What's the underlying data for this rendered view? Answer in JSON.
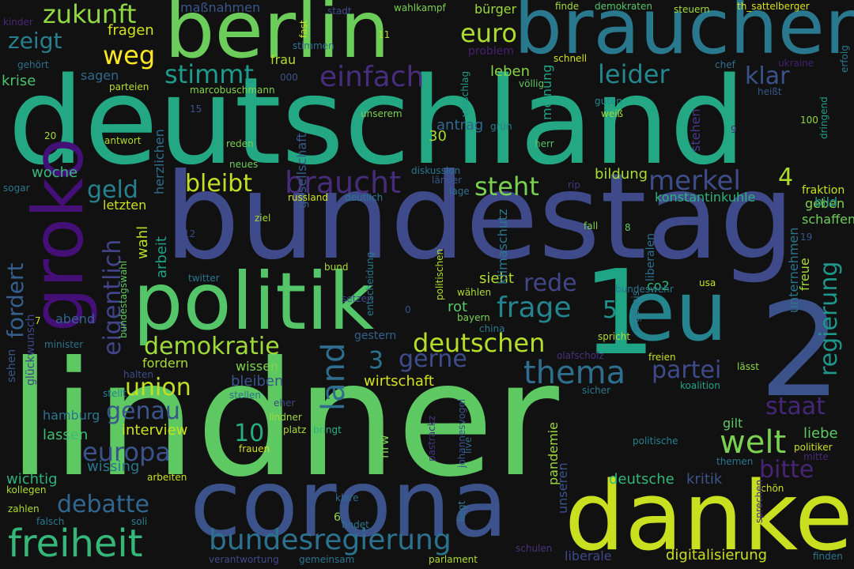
{
  "words": [
    {
      "text": "deutschland",
      "color": "#23a883"
    },
    {
      "text": "bundestag",
      "color": "#3f4a8a"
    },
    {
      "text": "lindner",
      "color": "#5ec962"
    },
    {
      "text": "corona",
      "color": "#3b528b"
    },
    {
      "text": "danke",
      "color": "#c8e020"
    },
    {
      "text": "brauchen",
      "color": "#2a788e"
    },
    {
      "text": "berlin",
      "color": "#6ccd5a"
    },
    {
      "text": "politik",
      "color": "#54c568"
    },
    {
      "text": "eu",
      "color": "#25858e"
    },
    {
      "text": "2",
      "color": "#3b528b"
    },
    {
      "text": "1",
      "color": "#20a486"
    },
    {
      "text": "groko",
      "color": "#440f76"
    },
    {
      "text": "freiheit",
      "color": "#35b779"
    },
    {
      "text": "bundesregierung",
      "color": "#2c728e"
    },
    {
      "text": "thema",
      "color": "#2e6e8e"
    },
    {
      "text": "welt",
      "color": "#7ad151"
    },
    {
      "text": "deutschen",
      "color": "#b5de2b"
    },
    {
      "text": "einfach",
      "color": "#472d7b"
    },
    {
      "text": "braucht",
      "color": "#472c7a"
    },
    {
      "text": "bleibt",
      "color": "#c2df23"
    },
    {
      "text": "steht",
      "color": "#7ad151"
    },
    {
      "text": "merkel",
      "color": "#3e4c8a"
    },
    {
      "text": "zukunft",
      "color": "#90d743"
    },
    {
      "text": "zeigt",
      "color": "#277f8e"
    },
    {
      "text": "weg",
      "color": "#fde725"
    },
    {
      "text": "euro",
      "color": "#addc30"
    },
    {
      "text": "stimmt",
      "color": "#1e9b8a"
    },
    {
      "text": "leider",
      "color": "#24868e"
    },
    {
      "text": "klar",
      "color": "#3b528b"
    },
    {
      "text": "demokratie",
      "color": "#9fda3a"
    },
    {
      "text": "frage",
      "color": "#25838e"
    },
    {
      "text": "rede",
      "color": "#404688"
    },
    {
      "text": "partei",
      "color": "#3e4a89"
    },
    {
      "text": "union",
      "color": "#c0df25"
    },
    {
      "text": "genau",
      "color": "#3a548c"
    },
    {
      "text": "europa",
      "color": "#3b528b"
    },
    {
      "text": "debatte",
      "color": "#31678e"
    },
    {
      "text": "land",
      "color": "#2e6d8e"
    },
    {
      "text": "staat",
      "color": "#482677"
    },
    {
      "text": "bitte",
      "color": "#482475"
    },
    {
      "text": "regierung",
      "color": "#1f968b"
    },
    {
      "text": "geld",
      "color": "#26818e"
    },
    {
      "text": "eigentlich",
      "color": "#414487"
    },
    {
      "text": "fordert",
      "color": "#355f8d"
    },
    {
      "text": "gerne",
      "color": "#3d4d8a"
    },
    {
      "text": "4",
      "color": "#addc30"
    },
    {
      "text": "5",
      "color": "#20928c"
    },
    {
      "text": "3",
      "color": "#2c718e"
    },
    {
      "text": "10",
      "color": "#27ad81"
    },
    {
      "text": "wissing",
      "color": "#2a768e"
    },
    {
      "text": "wichtig",
      "color": "#2db27d"
    },
    {
      "text": "interview",
      "color": "#cae11f"
    },
    {
      "text": "wirtschaft",
      "color": "#d2e21b"
    },
    {
      "text": "digitalisierung",
      "color": "#c5e021"
    },
    {
      "text": "deutsche",
      "color": "#34b679"
    },
    {
      "text": "kritik",
      "color": "#3b528b"
    },
    {
      "text": "liebe",
      "color": "#5ec962"
    },
    {
      "text": "bildung",
      "color": "#a8db34"
    },
    {
      "text": "antrag",
      "color": "#31688e"
    },
    {
      "text": "woche",
      "color": "#37b878"
    },
    {
      "text": "lassen",
      "color": "#3fbc73"
    },
    {
      "text": "hamburg",
      "color": "#2a768e"
    },
    {
      "text": "abend",
      "color": "#32658e"
    },
    {
      "text": "sieht",
      "color": "#b0dd2f"
    },
    {
      "text": "rot",
      "color": "#56c667"
    },
    {
      "text": "gestern",
      "color": "#34618d"
    },
    {
      "text": "leben",
      "color": "#87d549"
    },
    {
      "text": "fragen",
      "color": "#d2e21b"
    },
    {
      "text": "sagen",
      "color": "#31688e"
    },
    {
      "text": "krise",
      "color": "#4ac16d"
    },
    {
      "text": "letzten",
      "color": "#c8e020"
    },
    {
      "text": "wahl",
      "color": "#b8de29"
    },
    {
      "text": "arbeit",
      "color": "#1fa088"
    },
    {
      "text": "bleiben",
      "color": "#3a548c"
    },
    {
      "text": "wissen",
      "color": "#7fd34e"
    },
    {
      "text": "fordern",
      "color": "#a8db34"
    },
    {
      "text": "konstantinkuhle",
      "color": "#2db27d"
    },
    {
      "text": "geben",
      "color": "#84d44b"
    },
    {
      "text": "schaffen",
      "color": "#6ccd5a"
    },
    {
      "text": "freue",
      "color": "#a5db36"
    },
    {
      "text": "unternehmen",
      "color": "#2b758e"
    },
    {
      "text": "fraktion",
      "color": "#c8e020"
    },
    {
      "text": "bild",
      "color": "#1f968b"
    },
    {
      "text": "gilt",
      "color": "#5ec962"
    },
    {
      "text": "nrw",
      "color": "#7ad151"
    },
    {
      "text": "pandemie",
      "color": "#9bd93c"
    },
    {
      "text": "unseren",
      "color": "#39558c"
    },
    {
      "text": "problem",
      "color": "#482071"
    },
    {
      "text": "frau",
      "color": "#b5de2b"
    },
    {
      "text": "maßnahmen",
      "color": "#39568c"
    },
    {
      "text": "bürger",
      "color": "#9bd93c"
    },
    {
      "text": "meinung",
      "color": "#21a685"
    },
    {
      "text": "klimaschutz",
      "color": "#2a778e"
    },
    {
      "text": "co2",
      "color": "#35b779"
    },
    {
      "text": "liberalen",
      "color": "#2d708e"
    },
    {
      "text": "liberale",
      "color": "#3e4989"
    },
    {
      "text": "gesellschaft",
      "color": "#38598c"
    },
    {
      "text": "herzlichen",
      "color": "#2e6e8e"
    },
    {
      "text": "glückwunsch",
      "color": "#414487"
    },
    {
      "text": "sehen",
      "color": "#39568c"
    },
    {
      "text": "stehen",
      "color": "#443b84"
    },
    {
      "text": "marcobuschmann",
      "color": "#84d44b"
    },
    {
      "text": "parteien",
      "color": "#bddf26"
    },
    {
      "text": "wahlkampf",
      "color": "#7ad151"
    },
    {
      "text": "demokraten",
      "color": "#54c568"
    },
    {
      "text": "th_sattelberger",
      "color": "#d8e219"
    },
    {
      "text": "steuern",
      "color": "#a0da39"
    },
    {
      "text": "finde",
      "color": "#a2da37"
    },
    {
      "text": "stadt",
      "color": "#3e4c8a"
    },
    {
      "text": "fast",
      "color": "#d2e21b"
    },
    {
      "text": "kinder",
      "color": "#482878"
    },
    {
      "text": "gehört",
      "color": "#2d708e"
    },
    {
      "text": "erfolg",
      "color": "#29798e"
    },
    {
      "text": "ukraine",
      "color": "#481f70"
    },
    {
      "text": "chef",
      "color": "#2e6f8e"
    },
    {
      "text": "heißt",
      "color": "#38598c"
    },
    {
      "text": "schnell",
      "color": "#d2e21b"
    },
    {
      "text": "völlig",
      "color": "#5ec962"
    },
    {
      "text": "vorschlag",
      "color": "#1e9c89"
    },
    {
      "text": "guten",
      "color": "#23898e"
    },
    {
      "text": "weiß",
      "color": "#a0da39"
    },
    {
      "text": "grün",
      "color": "#26828e"
    },
    {
      "text": "unserem",
      "color": "#7ad151"
    },
    {
      "text": "herr",
      "color": "#54c568"
    },
    {
      "text": "dringend",
      "color": "#1fa088"
    },
    {
      "text": "100",
      "color": "#90d743"
    },
    {
      "text": "9",
      "color": "#482878"
    },
    {
      "text": "15",
      "color": "#3a548c"
    },
    {
      "text": "20",
      "color": "#a8db34"
    },
    {
      "text": "11",
      "color": "#addc30"
    },
    {
      "text": "000",
      "color": "#3b528b"
    },
    {
      "text": "stimmen",
      "color": "#2c728e"
    },
    {
      "text": "antwort",
      "color": "#addc30"
    },
    {
      "text": "reden",
      "color": "#7ad151"
    },
    {
      "text": "neues",
      "color": "#6ccd5a"
    },
    {
      "text": "diskussion",
      "color": "#2a768e"
    },
    {
      "text": "länder",
      "color": "#39568c"
    },
    {
      "text": "lage",
      "color": "#2c728e"
    },
    {
      "text": "rip",
      "color": "#46337e"
    },
    {
      "text": "sogar",
      "color": "#2a768e"
    },
    {
      "text": "russland",
      "color": "#d2e21b"
    },
    {
      "text": "deutlich",
      "color": "#2a788e"
    },
    {
      "text": "ziel",
      "color": "#a0da39"
    },
    {
      "text": "politischen",
      "color": "#b5de2b"
    },
    {
      "text": "entscheidung",
      "color": "#2a778e"
    },
    {
      "text": "fall",
      "color": "#7ad151"
    },
    {
      "text": "8",
      "color": "#5ec962"
    },
    {
      "text": "19",
      "color": "#3a548c"
    },
    {
      "text": "12",
      "color": "#3e4989"
    },
    {
      "text": "bundestagswahl",
      "color": "#5ec962"
    },
    {
      "text": "twitter",
      "color": "#2a768e"
    },
    {
      "text": "bund",
      "color": "#a8db34"
    },
    {
      "text": "usa",
      "color": "#cae11f"
    },
    {
      "text": "bundeswehr",
      "color": "#2a768e"
    },
    {
      "text": "wählen",
      "color": "#addc30"
    },
    {
      "text": "setzen",
      "color": "#3e4c8a"
    },
    {
      "text": "bayern",
      "color": "#7ad151"
    },
    {
      "text": "china",
      "color": "#2a788e"
    },
    {
      "text": "ergebnis",
      "color": "#2a778e"
    },
    {
      "text": "spricht",
      "color": "#b0dd2f"
    },
    {
      "text": "olafscholz",
      "color": "#46337e"
    },
    {
      "text": "minister",
      "color": "#2c728e"
    },
    {
      "text": "0",
      "color": "#3b528b"
    },
    {
      "text": "7",
      "color": "#d8e219"
    },
    {
      "text": "halten",
      "color": "#3e4c8a"
    },
    {
      "text": "freien",
      "color": "#cae11f"
    },
    {
      "text": "lässt",
      "color": "#90d743"
    },
    {
      "text": "stellt",
      "color": "#26828e"
    },
    {
      "text": "stellen",
      "color": "#2c728e"
    },
    {
      "text": "sicher",
      "color": "#2a788e"
    },
    {
      "text": "koalition",
      "color": "#20a486"
    },
    {
      "text": "eher",
      "color": "#404688"
    },
    {
      "text": "lindner_small",
      "color": "#a0da39"
    },
    {
      "text": "platz",
      "color": "#addc30"
    },
    {
      "text": "bringt",
      "color": "#2db27d"
    },
    {
      "text": "frauen",
      "color": "#d2e21b"
    },
    {
      "text": "pastrackz",
      "color": "#46337e"
    },
    {
      "text": "johannesvogel",
      "color": "#3a548c"
    },
    {
      "text": "live",
      "color": "#31688e"
    },
    {
      "text": "politische",
      "color": "#26828e"
    },
    {
      "text": "themen",
      "color": "#2a768e"
    },
    {
      "text": "politiker",
      "color": "#cae11f"
    },
    {
      "text": "mitte",
      "color": "#482878"
    },
    {
      "text": "schön",
      "color": "#cae11f"
    },
    {
      "text": "arbeiten",
      "color": "#c8e020"
    },
    {
      "text": "kollegen",
      "color": "#addc30"
    },
    {
      "text": "zahlen",
      "color": "#addc30"
    },
    {
      "text": "falsch",
      "color": "#2a788e"
    },
    {
      "text": "soli",
      "color": "#26828e"
    },
    {
      "text": "klare",
      "color": "#31688e"
    },
    {
      "text": "6",
      "color": "#90d743"
    },
    {
      "text": "findet",
      "color": "#2c728e"
    },
    {
      "text": "liegt",
      "color": "#2a768e"
    },
    {
      "text": "sprechen",
      "color": "#46337e"
    },
    {
      "text": "finden",
      "color": "#2a768e"
    },
    {
      "text": "schulen",
      "color": "#46337e"
    },
    {
      "text": "parlament",
      "color": "#addc30"
    },
    {
      "text": "verantwortung",
      "color": "#3e4c8a"
    },
    {
      "text": "gemeinsam",
      "color": "#2a768e"
    },
    {
      "text": "30",
      "color": "#a8db34"
    }
  ]
}
